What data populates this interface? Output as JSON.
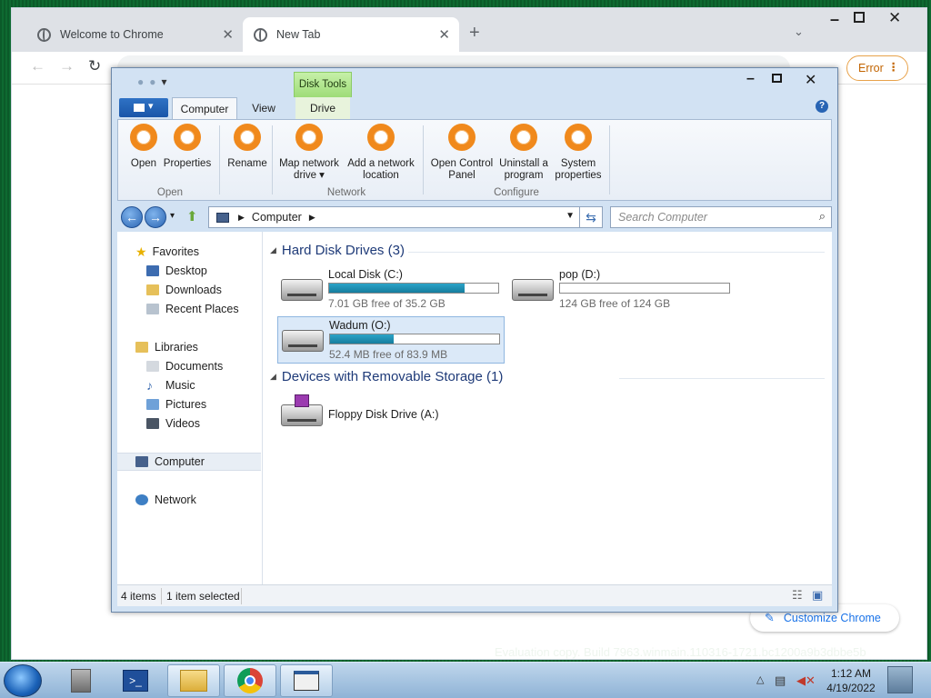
{
  "chrome": {
    "tabs": [
      {
        "title": "Welcome to Chrome",
        "active": false
      },
      {
        "title": "New Tab",
        "active": true
      }
    ],
    "omnibox_value": "",
    "error_label": "Error",
    "customize_label": "Customize Chrome"
  },
  "explorer": {
    "context_tab": "Disk Tools",
    "ribbon_tabs": [
      "Computer",
      "View",
      "Drive"
    ],
    "ribbon_buttons": [
      {
        "label": "Open",
        "group": "Open"
      },
      {
        "label": "Properties",
        "group": "Open"
      },
      {
        "label": "Rename",
        "group": ""
      },
      {
        "label": "Map network drive ▾",
        "group": "Network"
      },
      {
        "label": "Add a network location",
        "group": "Network"
      },
      {
        "label": "Open Control Panel",
        "group": "Configure"
      },
      {
        "label": "Uninstall a program",
        "group": "Configure"
      },
      {
        "label": "System properties",
        "group": "Configure"
      }
    ],
    "ribbon_groups": [
      "Open",
      "Network",
      "Configure"
    ],
    "address": "Computer",
    "search_placeholder": "Search Computer",
    "nav": {
      "favorites": "Favorites",
      "favorites_items": [
        "Desktop",
        "Downloads",
        "Recent Places"
      ],
      "libraries": "Libraries",
      "libraries_items": [
        "Documents",
        "Music",
        "Pictures",
        "Videos"
      ],
      "computer": "Computer",
      "network": "Network"
    },
    "sections": {
      "hard_disks": "Hard Disk Drives (3)",
      "removable": "Devices with Removable Storage (1)"
    },
    "drives": [
      {
        "name": "Local Disk (C:)",
        "free": "7.01 GB free of 35.2 GB",
        "used_fraction": 0.8,
        "selected": false
      },
      {
        "name": "pop (D:)",
        "free": "124 GB free of 124 GB",
        "used_fraction": 0.0,
        "selected": false
      },
      {
        "name": "Wadum (O:)",
        "free": "52.4 MB free of 83.9 MB",
        "used_fraction": 0.375,
        "selected": true
      }
    ],
    "floppy": "Floppy Disk Drive (A:)",
    "status": {
      "items": "4 items",
      "selected": "1 item selected"
    }
  },
  "watermark": "Evaluation copy. Build 7963.winmain.110316-1721.bc1200a9b3dbbe5b",
  "taskbar": {
    "time": "1:12 AM",
    "date": "4/19/2022"
  },
  "colors": {
    "ring": "#f0891c",
    "bar_fill": "#1f90b5",
    "chrome_error": "#c26401"
  }
}
